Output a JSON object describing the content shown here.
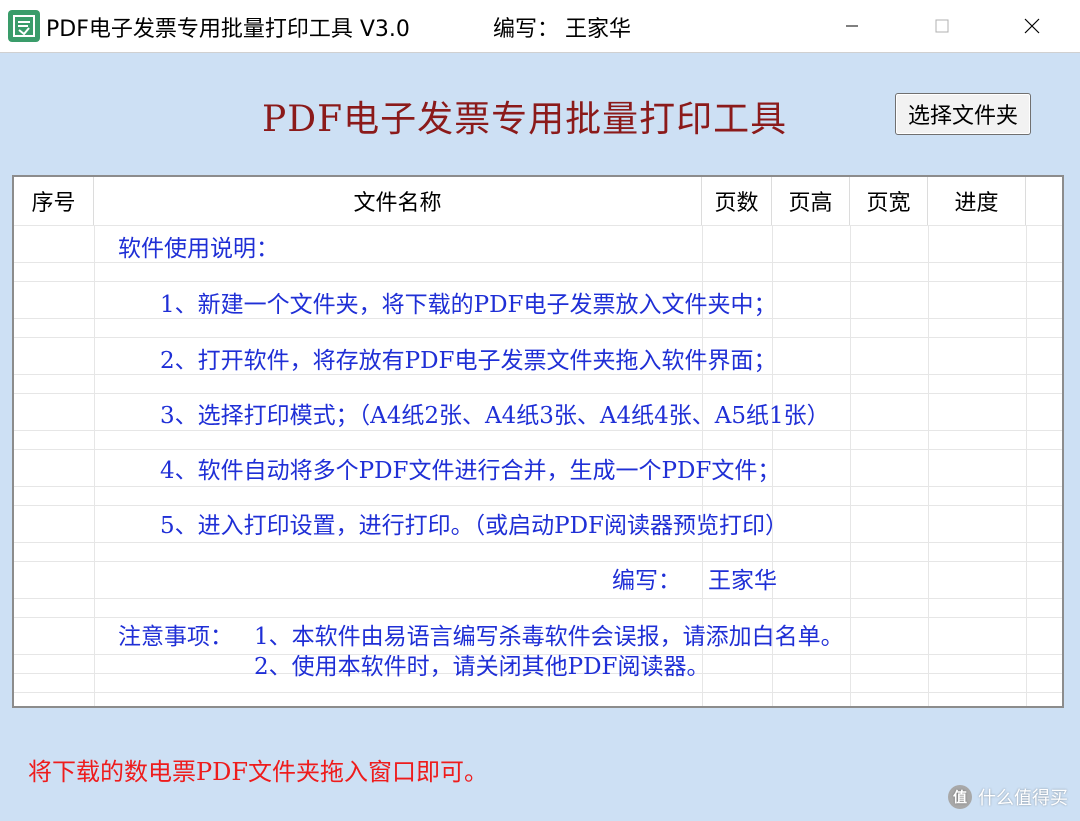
{
  "window": {
    "title": "PDF电子发票专用批量打印工具 V3.0",
    "author_label": "编写：",
    "author": "王家华",
    "controls": [
      "minimize",
      "maximize",
      "close"
    ]
  },
  "main": {
    "heading": "PDF电子发票专用批量打印工具",
    "select_folder_button": "选择文件夹"
  },
  "table": {
    "columns": [
      "序号",
      "文件名称",
      "页数",
      "页高",
      "页宽",
      "进度"
    ]
  },
  "instructions": {
    "title": "软件使用说明：",
    "steps": [
      "1、新建一个文件夹，将下载的PDF电子发票放入文件夹中；",
      "2、打开软件，将存放有PDF电子发票文件夹拖入软件界面；",
      "3、选择打印模式；（A4纸2张、A4纸3张、A4纸4张、A5纸1张）",
      "4、软件自动将多个PDF文件进行合并，生成一个PDF文件；",
      "5、进入打印设置，进行打印。（或启动PDF阅读器预览打印）"
    ],
    "author_line_label": "编写：",
    "author_line_name": "王家华",
    "notice_label": "注意事项：",
    "notice_1": "1、本软件由易语言编写杀毒软件会误报，请添加白名单。",
    "notice_2": "2、使用本软件时，请关闭其他PDF阅读器。"
  },
  "footer": {
    "hint": "将下载的数电票PDF文件夹拖入窗口即可。"
  },
  "watermark": {
    "badge": "值",
    "text": "什么值得买"
  },
  "colors": {
    "background": "#cde0f4",
    "heading": "#8b1a1a",
    "instructions": "#1f2fd6",
    "hint": "#ee1c1c"
  }
}
